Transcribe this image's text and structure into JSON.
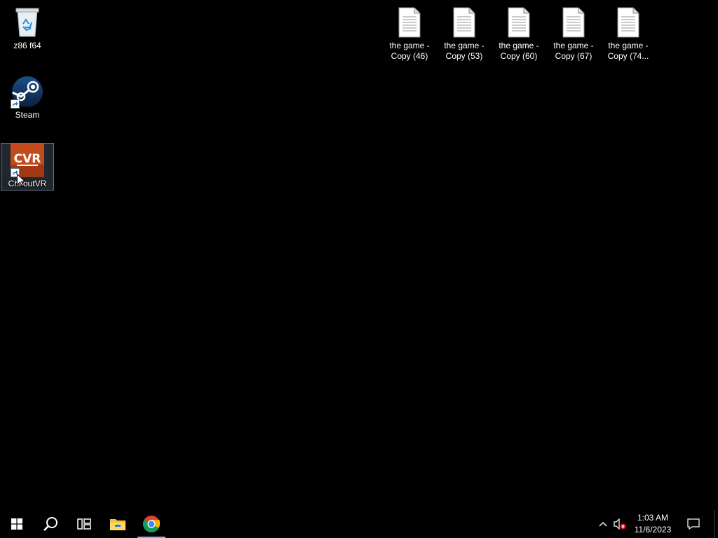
{
  "desktop_icons": [
    {
      "label": "z86 f64",
      "icon": "recycle-bin-icon"
    },
    {
      "label": "Steam",
      "icon": "steam-icon"
    },
    {
      "label": "ChkoutVR",
      "icon": "checkoutvr-icon"
    },
    {
      "label": "the game - Copy (46)",
      "icon": "text-file-icon"
    },
    {
      "label": "the game - Copy (53)",
      "icon": "text-file-icon"
    },
    {
      "label": "the game - Copy (60)",
      "icon": "text-file-icon"
    },
    {
      "label": "the game - Copy (67)",
      "icon": "text-file-icon"
    },
    {
      "label": "the game - Copy (74...",
      "icon": "text-file-icon"
    }
  ],
  "taskbar": {
    "pinned": [
      "start-icon",
      "search-icon",
      "task-view-icon",
      "file-explorer-icon",
      "chrome-icon"
    ],
    "active_app": "chrome-icon"
  },
  "tray": {
    "time": "1:03 AM",
    "date": "11/6/2023",
    "volume_state": "muted"
  },
  "colors": {
    "desktop_bg": "#000000",
    "taskbar_bg": "#000000",
    "active_indicator": "#76b9ed"
  }
}
